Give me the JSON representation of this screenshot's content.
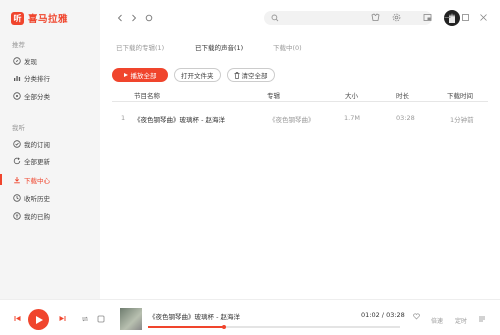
{
  "app": {
    "logo_glyph": "听",
    "name": "喜马拉雅",
    "accent": "#f0452d"
  },
  "sidebar": {
    "section_recommend": "推荐",
    "recommend_items": [
      {
        "label": "发现",
        "icon": "compass-icon"
      },
      {
        "label": "分类排行",
        "icon": "chart-icon"
      },
      {
        "label": "全部分类",
        "icon": "grid-icon"
      }
    ],
    "section_mine": "我听",
    "mine_items": [
      {
        "label": "我的订阅",
        "icon": "subscribe-icon"
      },
      {
        "label": "全部更新",
        "icon": "refresh-icon"
      },
      {
        "label": "下载中心",
        "icon": "download-icon",
        "active": true
      },
      {
        "label": "收听历史",
        "icon": "history-icon"
      },
      {
        "label": "我的已购",
        "icon": "purchased-icon"
      }
    ]
  },
  "tabs": [
    {
      "label": "已下载的专辑(1)",
      "active": false
    },
    {
      "label": "已下载的声音(1)",
      "active": true
    },
    {
      "label": "下载中(0)",
      "active": false
    }
  ],
  "actions": {
    "play_all": "播放全部",
    "open_folder": "打开文件夹",
    "clear_all": "清空全部"
  },
  "table": {
    "headers": {
      "title": "节目名称",
      "album": "专辑",
      "size": "大小",
      "duration": "时长",
      "time": "下载时间"
    },
    "rows": [
      {
        "index": "1",
        "title": "《夜色钢琴曲》玻璃杯 - 赵海洋",
        "album": "《夜色钢琴曲》",
        "size": "1.7M",
        "duration": "03:28",
        "time": "1分钟前"
      }
    ]
  },
  "player": {
    "track": "《夜色钢琴曲》玻璃杯 - 赵海洋",
    "time_current": "01:02",
    "time_total": "03:28",
    "progress": 0.3,
    "speed_label": "倍速",
    "timer_label": "定时"
  }
}
